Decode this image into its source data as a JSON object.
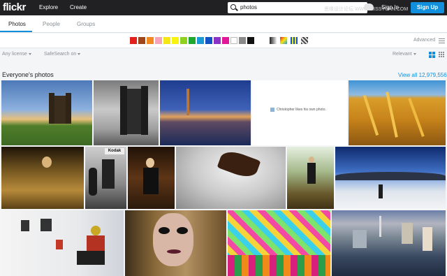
{
  "header": {
    "logo": "flickr",
    "nav": [
      "Explore",
      "Create"
    ],
    "search_value": "photos",
    "signin": "Sign In",
    "signup": "Sign Up",
    "watermark": "思缘设计论坛 WWW.MISSYUAN.COM"
  },
  "tabs": [
    {
      "label": "Photos",
      "active": true
    },
    {
      "label": "People",
      "active": false
    },
    {
      "label": "Groups",
      "active": false
    }
  ],
  "colors": [
    "#e3201b",
    "#a1461a",
    "#f28a1f",
    "#f6a5b8",
    "#f5e615",
    "#f9f40f",
    "#8fd11e",
    "#1fa830",
    "#1c9ad6",
    "#1155c4",
    "#8a34c7",
    "#e2189a",
    "#ffffff",
    "#8a8a8a",
    "#111111"
  ],
  "advanced_label": "Advanced",
  "filters": {
    "license": "Any license",
    "safesearch": "SafeSearch on",
    "sort": "Relevant"
  },
  "section": {
    "title": "Everyone's photos",
    "view_all": "View all 12,979,556"
  },
  "photo_caption": "Christopher likes his own photo.",
  "photos": [
    {
      "name": "photo-castle-tower-sunset"
    },
    {
      "name": "photo-castle-tower-bw"
    },
    {
      "name": "photo-harbor-town-night"
    },
    {
      "name": "photo-christopher-placeholder"
    },
    {
      "name": "photo-wheat-field"
    },
    {
      "name": "photo-woman-in-grass"
    },
    {
      "name": "photo-kodak-store-bw"
    },
    {
      "name": "photo-woman-forest"
    },
    {
      "name": "photo-leaf-on-ice"
    },
    {
      "name": "photo-girl-in-woods"
    },
    {
      "name": "photo-fisheye-snow-landscape"
    },
    {
      "name": "photo-gallery-reading"
    },
    {
      "name": "photo-face-paint-portrait"
    },
    {
      "name": "photo-psychedelic-pattern"
    },
    {
      "name": "photo-las-vegas-aerial"
    }
  ]
}
